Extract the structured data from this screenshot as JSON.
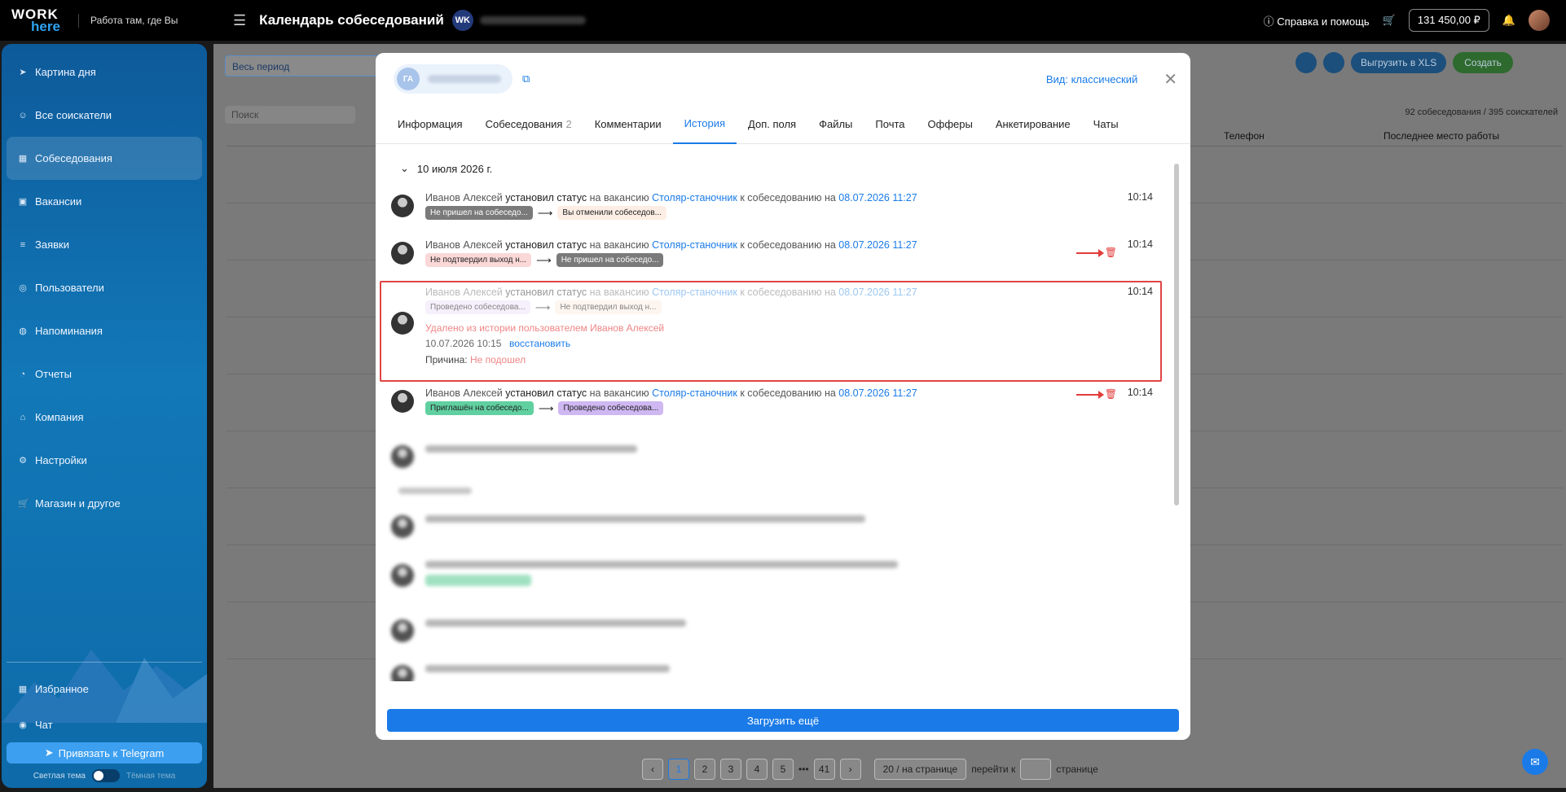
{
  "topbar": {
    "logo_line1": "WORK",
    "logo_line2": "here",
    "slogan": "Работа там, где Вы",
    "title": "Календарь собеседований",
    "company_badge": "WK",
    "help": "Справка и помощь",
    "balance": "131 450,00 ₽"
  },
  "sidebar": {
    "items": [
      {
        "label": "Картина дня",
        "icon": "rocket-icon"
      },
      {
        "label": "Все соискатели",
        "icon": "users-icon"
      },
      {
        "label": "Собеседования",
        "icon": "calendar-icon"
      },
      {
        "label": "Вакансии",
        "icon": "briefcase-icon"
      },
      {
        "label": "Заявки",
        "icon": "list-icon"
      },
      {
        "label": "Пользователи",
        "icon": "user-icon"
      },
      {
        "label": "Напоминания",
        "icon": "bell-icon"
      },
      {
        "label": "Отчеты",
        "icon": "report-icon"
      },
      {
        "label": "Компания",
        "icon": "home-icon"
      },
      {
        "label": "Настройки",
        "icon": "gear-icon"
      },
      {
        "label": "Магазин и другое",
        "icon": "cart-icon"
      }
    ],
    "favorites": "Избранное",
    "chat": "Чат",
    "telegram": "Привязать к Telegram",
    "light_theme": "Светлая тема",
    "dark_theme": "Тёмная тема"
  },
  "background": {
    "period": "Весь период",
    "search_placeholder": "Поиск",
    "counts": "92 собеседования / 395 соискателей",
    "col_phone": "Телефон",
    "col_last_job": "Последнее место работы",
    "export": "Выгрузить в XLS",
    "create": "Создать"
  },
  "modal": {
    "chip_initials": "ГА",
    "view": "Вид: классический",
    "tabs": [
      {
        "label": "Информация",
        "count": ""
      },
      {
        "label": "Собеседования",
        "count": "2"
      },
      {
        "label": "Комментарии",
        "count": ""
      },
      {
        "label": "История",
        "count": ""
      },
      {
        "label": "Доп. поля",
        "count": ""
      },
      {
        "label": "Файлы",
        "count": ""
      },
      {
        "label": "Почта",
        "count": ""
      },
      {
        "label": "Офферы",
        "count": ""
      },
      {
        "label": "Анкетирование",
        "count": ""
      },
      {
        "label": "Чаты",
        "count": ""
      }
    ],
    "date_group": "10 июля 2026 г.",
    "entries": [
      {
        "author": "Иванов Алексей",
        "action": "установил статус",
        "mid": "на вакансию",
        "vacancy": "Столяр-станочник",
        "mid2": "к собеседованию на",
        "date": "08.07.2026 11:27",
        "time": "10:14",
        "from": "Не пришел на собеседо...",
        "to": "Вы отменили собеседов..."
      },
      {
        "author": "Иванов Алексей",
        "action": "установил статус",
        "mid": "на вакансию",
        "vacancy": "Столяр-станочник",
        "mid2": "к собеседованию на",
        "date": "08.07.2026 11:27",
        "time": "10:14",
        "from": "Не подтвердил выход н...",
        "to": "Не пришел на собеседо..."
      },
      {
        "author": "Иванов Алексей",
        "action": "установил статус",
        "mid": "на вакансию",
        "vacancy": "Столяр-станочник",
        "mid2": "к собеседованию на",
        "date": "08.07.2026 11:27",
        "time": "10:14",
        "from": "Проведено собеседова...",
        "to": "Не подтвердил выход н...",
        "deleted_by": "Удалено из истории пользователем Иванов Алексей",
        "deleted_at": "10.07.2026 10:15",
        "restore": "восстановить",
        "reason_label": "Причина:",
        "reason": "Не подошел"
      },
      {
        "author": "Иванов Алексей",
        "action": "установил статус",
        "mid": "на вакансию",
        "vacancy": "Столяр-станочник",
        "mid2": "к собеседованию на",
        "date": "08.07.2026 11:27",
        "time": "10:14",
        "from": "Приглашён на собеседо...",
        "to": "Проведено собеседова..."
      }
    ],
    "load_more": "Загрузить ещё"
  },
  "pager": {
    "pages": [
      "1",
      "2",
      "3",
      "4",
      "5",
      "•••",
      "41"
    ],
    "per_page": "20 / на странице",
    "goto": "перейти к",
    "page_word": "странице"
  },
  "colors": {
    "accent": "#1a7be8",
    "danger": "#e23b3b"
  }
}
